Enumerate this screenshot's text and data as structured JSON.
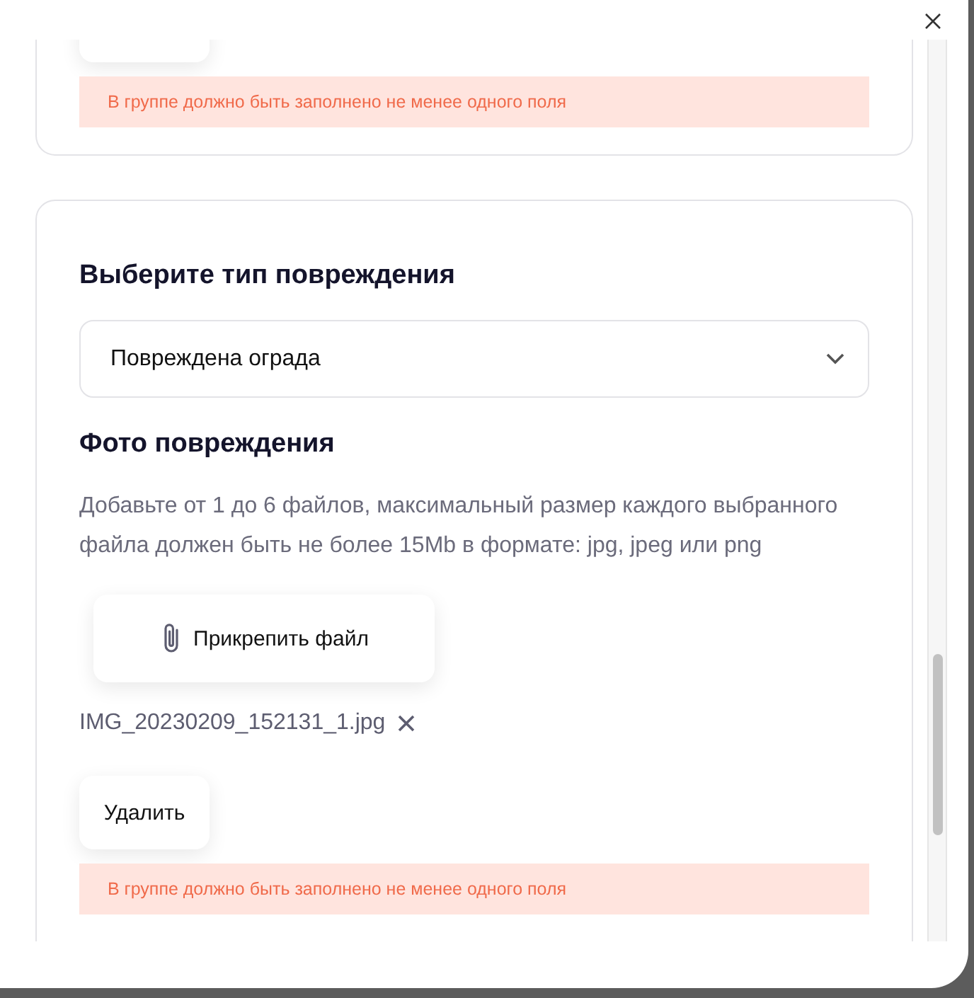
{
  "cards": [
    {
      "kind": "partial",
      "error": "В группе должно быть заполнено не менее одного поля"
    },
    {
      "kind": "damage",
      "title": "Выберите тип повреждения",
      "select": {
        "value": "Повреждена ограда"
      },
      "photo_title": "Фото повреждения",
      "hint": "Добавьте от 1 до 6 файлов, максимальный размер каждого выбранного файла должен быть не более 15Mb в формате: jpg, jpeg или png",
      "attach_button": "Прикрепить файл",
      "files": [
        {
          "name": "IMG_20230209_152131_1.jpg"
        }
      ],
      "delete_button": "Удалить",
      "error": "В группе должно быть заполнено не менее одного поля"
    }
  ]
}
